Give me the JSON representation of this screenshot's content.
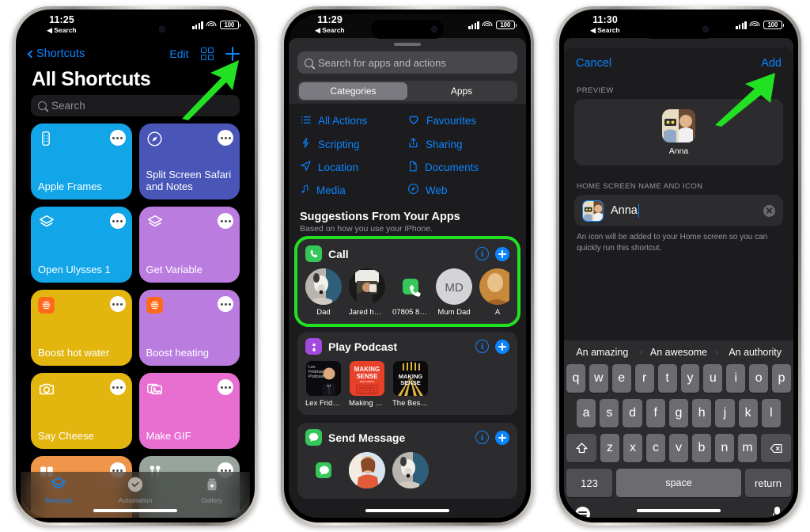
{
  "phone1": {
    "status": {
      "time": "11:25",
      "back": "Search",
      "battery": "100"
    },
    "nav": {
      "back_label": "Shortcuts",
      "edit_label": "Edit",
      "grid_icon": "grid-icon",
      "add_icon": "plus-icon"
    },
    "title": "All Shortcuts",
    "search_placeholder": "Search",
    "tiles": [
      {
        "label": "Apple Frames",
        "color": "#12a6e8",
        "icon": "remote-icon"
      },
      {
        "label": "Split Screen Safari and Notes",
        "color": "#4a55b8",
        "icon": "compass-icon"
      },
      {
        "label": "Open Ulysses 1",
        "color": "#12a6e8",
        "icon": "layers-icon"
      },
      {
        "label": "Get Variable",
        "color": "#bb7ce0",
        "icon": "layers-icon"
      },
      {
        "label": "Boost hot water",
        "color": "#e2b60e",
        "icon": "hive-icon"
      },
      {
        "label": "Boost heating",
        "color": "#bb7ce0",
        "icon": "hive-icon"
      },
      {
        "label": "Say Cheese",
        "color": "#e2b60e",
        "icon": "camera-icon"
      },
      {
        "label": "Make GIF",
        "color": "#e96ed2",
        "icon": "photos-icon"
      },
      {
        "label": "",
        "color": "#f0964a",
        "icon": "books-icon"
      },
      {
        "label": "",
        "color": "#97a39b",
        "icon": "airpods-icon"
      }
    ],
    "tabs": [
      {
        "label": "Shortcuts",
        "icon": "layers-icon",
        "active": true,
        "color": "#0a84ff"
      },
      {
        "label": "Automation",
        "icon": "clock-icon",
        "active": false,
        "color": "#98989d"
      },
      {
        "label": "Gallery",
        "icon": "sparkle-jar-icon",
        "active": false,
        "color": "#98989d"
      }
    ]
  },
  "phone2": {
    "status": {
      "time": "11:29",
      "back": "Search",
      "battery": "100"
    },
    "search_placeholder": "Search for apps and actions",
    "segments": [
      {
        "label": "Categories",
        "selected": true
      },
      {
        "label": "Apps",
        "selected": false
      }
    ],
    "categories": [
      {
        "label": "All Actions",
        "icon": "list-icon"
      },
      {
        "label": "Favourites",
        "icon": "heart-icon"
      },
      {
        "label": "Scripting",
        "icon": "scripting-icon"
      },
      {
        "label": "Sharing",
        "icon": "share-icon"
      },
      {
        "label": "Location",
        "icon": "location-arrow-icon"
      },
      {
        "label": "Documents",
        "icon": "document-icon"
      },
      {
        "label": "Media",
        "icon": "music-note-icon"
      },
      {
        "label": "Web",
        "icon": "safari-icon"
      }
    ],
    "suggestions_header": "Suggestions From Your Apps",
    "suggestions_sub": "Based on how you use your iPhone.",
    "highlight_color": "#22e022",
    "cards": [
      {
        "title": "Call",
        "app_color": "#35c759",
        "app_icon": "phone-icon",
        "info_label": "i",
        "add_icon": "plus-icon",
        "highlighted": true,
        "items": [
          {
            "label": "Dad",
            "kind": "photo-dog"
          },
          {
            "label": "Jared hard...",
            "kind": "photo-person"
          },
          {
            "label": "07805 878...",
            "kind": "phone-glyph"
          },
          {
            "label": "Mum Dad",
            "kind": "initials",
            "initials": "MD"
          },
          {
            "label": "A",
            "kind": "photo-partial"
          }
        ]
      },
      {
        "title": "Play Podcast",
        "app_color": "#a24ae0",
        "app_icon": "podcast-icon",
        "info_label": "i",
        "add_icon": "plus-icon",
        "highlighted": false,
        "items": [
          {
            "label": "Lex Fridma...",
            "kind": "art-lex"
          },
          {
            "label": "Making Sen...",
            "kind": "art-making"
          },
          {
            "label": "The Best of...",
            "kind": "art-best"
          }
        ]
      },
      {
        "title": "Send Message",
        "app_color": "#35c759",
        "app_icon": "message-icon",
        "info_label": "i",
        "add_icon": "plus-icon",
        "highlighted": false,
        "items": [
          {
            "label": "",
            "kind": "message-glyph"
          },
          {
            "label": "",
            "kind": "photo-woman"
          },
          {
            "label": "",
            "kind": "photo-dog"
          }
        ]
      }
    ]
  },
  "phone3": {
    "status": {
      "time": "11:30",
      "back": "Search",
      "battery": "100"
    },
    "nav": {
      "cancel_label": "Cancel",
      "add_label": "Add"
    },
    "preview_label": "PREVIEW",
    "preview_name": "Anna",
    "field_label": "HOME SCREEN NAME AND ICON",
    "field_value": "Anna",
    "help_text": "An icon will be added to your Home screen so you can quickly run this shortcut.",
    "predictions": [
      "An amazing",
      "An awesome",
      "An authority"
    ],
    "keyboard": {
      "row1": [
        "q",
        "w",
        "e",
        "r",
        "t",
        "y",
        "u",
        "i",
        "o",
        "p"
      ],
      "row2": [
        "a",
        "s",
        "d",
        "f",
        "g",
        "h",
        "j",
        "k",
        "l"
      ],
      "row3": [
        "z",
        "x",
        "c",
        "v",
        "b",
        "n",
        "m"
      ],
      "shift_icon": "shift-icon",
      "backspace_icon": "backspace-icon",
      "numbers_label": "123",
      "space_label": "space",
      "return_label": "return",
      "emoji_icon": "emoji-icon",
      "mic_icon": "microphone-icon"
    }
  }
}
